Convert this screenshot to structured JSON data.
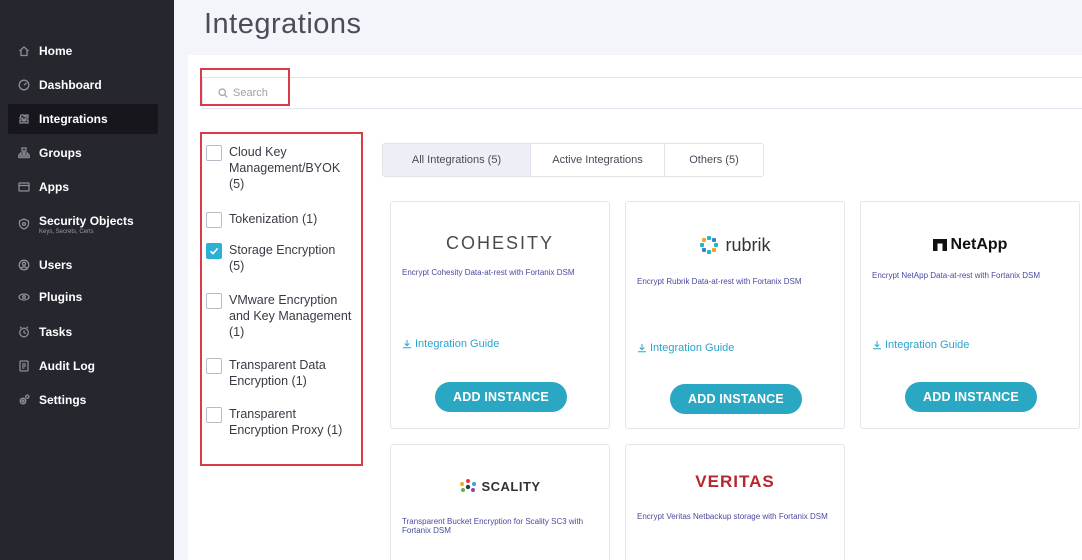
{
  "sidebar": {
    "items": [
      {
        "label": "Home",
        "icon": "home-icon"
      },
      {
        "label": "Dashboard",
        "icon": "dashboard-icon"
      },
      {
        "label": "Integrations",
        "icon": "integrations-icon",
        "active": true
      },
      {
        "label": "Groups",
        "icon": "groups-icon"
      },
      {
        "label": "Apps",
        "icon": "apps-icon"
      },
      {
        "label": "Security Objects",
        "sub": "Keys, Secrets, Certs",
        "icon": "security-objects-icon"
      },
      {
        "label": "Users",
        "icon": "users-icon"
      },
      {
        "label": "Plugins",
        "icon": "plugins-icon"
      },
      {
        "label": "Tasks",
        "icon": "tasks-icon"
      },
      {
        "label": "Audit Log",
        "icon": "audit-log-icon"
      },
      {
        "label": "Settings",
        "icon": "settings-icon"
      }
    ]
  },
  "page": {
    "title": "Integrations"
  },
  "search": {
    "placeholder": "Search",
    "value": ""
  },
  "filters": [
    {
      "label": "Cloud Key Management/BYOK",
      "count": "(5)",
      "checked": false
    },
    {
      "label": "Tokenization",
      "count": "(1)",
      "checked": false
    },
    {
      "label": "Storage Encryption",
      "count": "(5)",
      "checked": true
    },
    {
      "label": "VMware Encryption and Key Management",
      "count": "(1)",
      "checked": false
    },
    {
      "label": "Transparent Data Encryption",
      "count": "(1)",
      "checked": false
    },
    {
      "label": "Transparent Encryption Proxy",
      "count": "(1)",
      "checked": false
    }
  ],
  "tabs": [
    {
      "label": "All Integrations (5)",
      "active": true
    },
    {
      "label": "Active Integrations",
      "active": false
    },
    {
      "label": "Others (5)",
      "active": false
    }
  ],
  "cards": [
    {
      "logo": "COHESITY",
      "desc": "Encrypt Cohesity Data-at-rest with Fortanix DSM",
      "guide": "Integration Guide",
      "button": "ADD INSTANCE"
    },
    {
      "logo": "rubrik",
      "desc": "Encrypt Rubrik Data-at-rest with Fortanix DSM",
      "guide": "Integration Guide",
      "button": "ADD INSTANCE"
    },
    {
      "logo": "NetApp",
      "desc": "Encrypt NetApp Data-at-rest with Fortanix DSM",
      "guide": "Integration Guide",
      "button": "ADD INSTANCE"
    },
    {
      "logo": "SCALITY",
      "desc": "Transparent Bucket Encryption for Scality SC3 with Fortanix DSM"
    },
    {
      "logo": "VERITAS",
      "desc": "Encrypt Veritas Netbackup storage with Fortanix DSM"
    }
  ],
  "colors": {
    "sidebar_bg": "#26262f",
    "accent": "#2aa7c3",
    "highlight_border": "#d73c49",
    "veritas_red": "#b8262d"
  }
}
